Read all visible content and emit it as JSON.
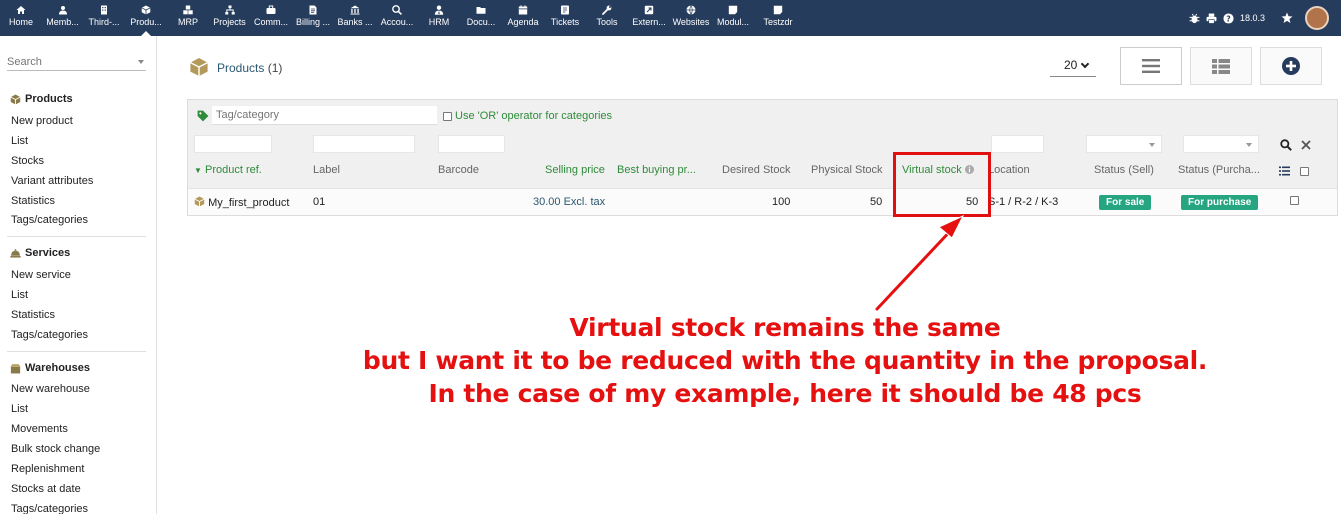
{
  "topnav": {
    "items": [
      {
        "label": "Home",
        "icon": "home-icon",
        "active": false
      },
      {
        "label": "Memb...",
        "icon": "member-icon",
        "active": false
      },
      {
        "label": "Third-...",
        "icon": "building-icon",
        "active": false
      },
      {
        "label": "Produ...",
        "icon": "cube-icon",
        "active": true
      },
      {
        "label": "MRP",
        "icon": "cubes-icon",
        "active": false
      },
      {
        "label": "Projects",
        "icon": "sitemap-icon",
        "active": false
      },
      {
        "label": "Comm...",
        "icon": "suitcase-icon",
        "active": false
      },
      {
        "label": "Billing ...",
        "icon": "invoice-icon",
        "active": false
      },
      {
        "label": "Banks ...",
        "icon": "bank-icon",
        "active": false
      },
      {
        "label": "Accou...",
        "icon": "search-dollar-icon",
        "active": false
      },
      {
        "label": "HRM",
        "icon": "user-tie-icon",
        "active": false
      },
      {
        "label": "Docu...",
        "icon": "folder-icon",
        "active": false
      },
      {
        "label": "Agenda",
        "icon": "calendar-icon",
        "active": false
      },
      {
        "label": "Tickets",
        "icon": "ticket-icon",
        "active": false
      },
      {
        "label": "Tools",
        "icon": "wrench-icon",
        "active": false
      },
      {
        "label": "Extern...",
        "icon": "external-link-icon",
        "active": false
      },
      {
        "label": "Websites",
        "icon": "globe-icon",
        "active": false
      },
      {
        "label": "Modul...",
        "icon": "module-icon",
        "active": false
      },
      {
        "label": "Testzdr",
        "icon": "module-icon",
        "active": false
      }
    ],
    "version": "18.0.3",
    "right_icons": [
      "bug-icon",
      "printer-icon",
      "help-icon",
      "star-icon",
      "user-avatar"
    ]
  },
  "sidebar": {
    "search_placeholder": "Search",
    "sections": [
      {
        "title": "Products",
        "icon": "cube-icon",
        "items": [
          "New product",
          "List",
          "Stocks",
          "Variant attributes",
          "Statistics",
          "Tags/categories"
        ]
      },
      {
        "title": "Services",
        "icon": "concierge-bell-icon",
        "items": [
          "New service",
          "List",
          "Statistics",
          "Tags/categories"
        ]
      },
      {
        "title": "Warehouses",
        "icon": "box-open-icon",
        "items": [
          "New warehouse",
          "List",
          "Movements",
          "Bulk stock change",
          "Replenishment",
          "Stocks at date",
          "Tags/categories"
        ]
      }
    ]
  },
  "main": {
    "title": "Products",
    "count": "(1)",
    "limit": "20",
    "tag_placeholder": "Tag/category",
    "or_operator_label": "Use 'OR' operator for categories",
    "columns": [
      {
        "label": "Product ref.",
        "green": true,
        "sorted": true
      },
      {
        "label": "Label",
        "green": false
      },
      {
        "label": "Barcode",
        "green": false
      },
      {
        "label": "Selling price",
        "green": true
      },
      {
        "label": "Best buying pr...",
        "green": true
      },
      {
        "label": "Desired Stock",
        "green": false
      },
      {
        "label": "Physical Stock",
        "green": false
      },
      {
        "label": "Virtual stock",
        "green": true
      },
      {
        "label": "Location",
        "green": false
      },
      {
        "label": "Status (Sell)",
        "green": false
      },
      {
        "label": "Status (Purcha...",
        "green": false
      }
    ],
    "rows": [
      {
        "ref": "My_first_product",
        "label": "01",
        "barcode": "",
        "selling_price": "30.00 Excl. tax",
        "best_buying_price": "",
        "desired_stock": "100",
        "physical_stock": "50",
        "virtual_stock": "50",
        "location": "S-1 / R-2 / K-3",
        "status_sell": "For sale",
        "status_buy": "For purchase"
      }
    ]
  },
  "annotation": {
    "lines": [
      "Virtual stock remains the same",
      "but I want it to be reduced with the quantity in the proposal.",
      "In the case of my example, here it should be 48 pcs"
    ],
    "color": "#e51010"
  },
  "colors": {
    "nav_bg": "#263c5c",
    "badge_green": "#25a580",
    "link_blue": "#2a5872",
    "header_green": "#2f8b3a"
  }
}
